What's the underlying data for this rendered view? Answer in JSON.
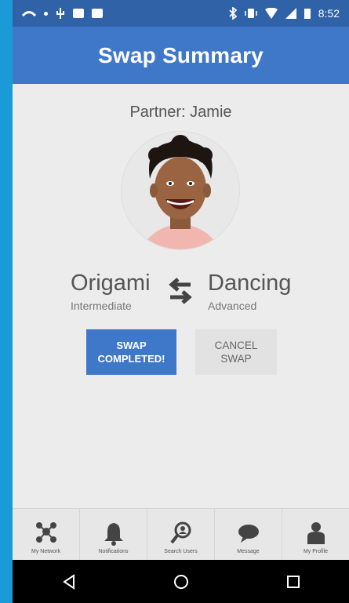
{
  "status_bar": {
    "time": "8:52"
  },
  "app_bar": {
    "title": "Swap Summary"
  },
  "partner": {
    "label": "Partner: Jamie"
  },
  "swap": {
    "left": {
      "skill": "Origami",
      "level": "Intermediate"
    },
    "right": {
      "skill": "Dancing",
      "level": "Advanced"
    }
  },
  "buttons": {
    "complete_line1": "SWAP",
    "complete_line2": "COMPLETED!",
    "cancel_line1": "CANCEL",
    "cancel_line2": "SWAP"
  },
  "bottom_nav": {
    "items": [
      {
        "label": "My Network",
        "icon": "network-icon"
      },
      {
        "label": "Notifications",
        "icon": "bell-icon"
      },
      {
        "label": "Search Users",
        "icon": "search-users-icon"
      },
      {
        "label": "Message",
        "icon": "message-icon"
      },
      {
        "label": "My Profile",
        "icon": "profile-icon"
      }
    ]
  },
  "colors": {
    "app_bar": "#3f78c9",
    "status_bar": "#2f62a7",
    "background": "#ececec",
    "accent_button": "#3f78c9",
    "outer": "#1a9bd7"
  }
}
